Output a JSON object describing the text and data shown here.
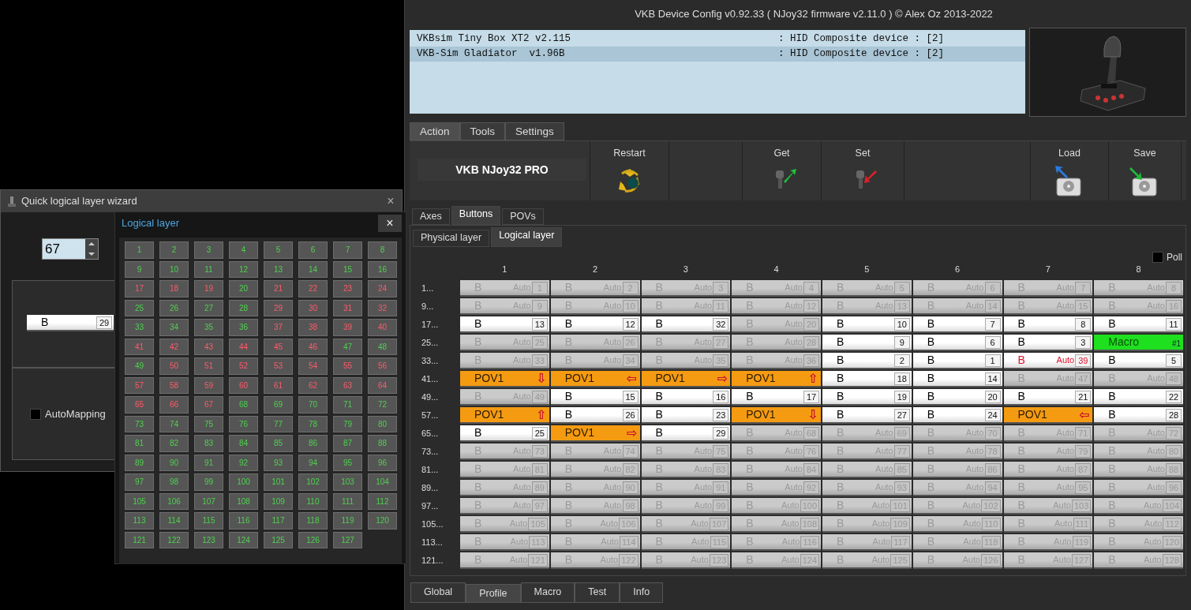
{
  "main_window": {
    "title": "VKB Device Config v0.92.33 ( NJoy32 firmware v2.11.0 ) © Alex Oz 2013-2022",
    "devices": [
      {
        "name": "VKBsim Tiny Box XT2 v2.115",
        "info": ": HID Composite device : [2]",
        "selected": false
      },
      {
        "name": "VKB-Sim Gladiator  v1.96B",
        "info": ": HID Composite device : [2]",
        "selected": true
      }
    ],
    "tabs": [
      {
        "label": "Action",
        "selected": true
      },
      {
        "label": "Tools",
        "selected": false
      },
      {
        "label": "Settings",
        "selected": false
      }
    ],
    "toolbar": {
      "device_label": "VKB NJoy32 PRO",
      "actions": [
        {
          "label": "Restart",
          "kind": "restart"
        },
        {
          "label": "Get",
          "kind": "get"
        },
        {
          "label": "Set",
          "kind": "set"
        },
        {
          "label": "Load",
          "kind": "load"
        },
        {
          "label": "Save",
          "kind": "save"
        }
      ]
    },
    "sub_tabs": [
      {
        "label": "Axes",
        "selected": false
      },
      {
        "label": "Buttons",
        "selected": true
      },
      {
        "label": "POVs",
        "selected": false
      }
    ],
    "layer_tabs": [
      {
        "label": "Physical layer",
        "selected": false
      },
      {
        "label": "Logical layer",
        "selected": true
      }
    ],
    "poll": {
      "label": "Poll",
      "checked": false
    },
    "columns": [
      "1",
      "2",
      "3",
      "4",
      "5",
      "6",
      "7",
      "8"
    ],
    "rows": [
      {
        "label": "1...",
        "cells": [
          {
            "kind": "auto",
            "text": "B",
            "mode": "Auto",
            "number": "1"
          },
          {
            "kind": "auto",
            "text": "B",
            "mode": "Auto",
            "number": "2"
          },
          {
            "kind": "auto",
            "text": "B",
            "mode": "Auto",
            "number": "3"
          },
          {
            "kind": "auto",
            "text": "B",
            "mode": "Auto",
            "number": "4"
          },
          {
            "kind": "auto",
            "text": "B",
            "mode": "Auto",
            "number": "5"
          },
          {
            "kind": "auto",
            "text": "B",
            "mode": "Auto",
            "number": "6"
          },
          {
            "kind": "auto",
            "text": "B",
            "mode": "Auto",
            "number": "7"
          },
          {
            "kind": "auto",
            "text": "B",
            "mode": "Auto",
            "number": "8"
          }
        ]
      },
      {
        "label": "9...",
        "cells": [
          {
            "kind": "auto",
            "text": "B",
            "mode": "Auto",
            "number": "9"
          },
          {
            "kind": "auto",
            "text": "B",
            "mode": "Auto",
            "number": "10"
          },
          {
            "kind": "auto",
            "text": "B",
            "mode": "Auto",
            "number": "11"
          },
          {
            "kind": "auto",
            "text": "B",
            "mode": "Auto",
            "number": "12"
          },
          {
            "kind": "auto",
            "text": "B",
            "mode": "Auto",
            "number": "13"
          },
          {
            "kind": "auto",
            "text": "B",
            "mode": "Auto",
            "number": "14"
          },
          {
            "kind": "auto",
            "text": "B",
            "mode": "Auto",
            "number": "15"
          },
          {
            "kind": "auto",
            "text": "B",
            "mode": "Auto",
            "number": "16"
          }
        ]
      },
      {
        "label": "17...",
        "cells": [
          {
            "kind": "button",
            "text": "B",
            "number": "13"
          },
          {
            "kind": "button",
            "text": "B",
            "number": "12"
          },
          {
            "kind": "button",
            "text": "B",
            "number": "32"
          },
          {
            "kind": "auto",
            "text": "B",
            "mode": "Auto",
            "number": "20"
          },
          {
            "kind": "button",
            "text": "B",
            "number": "10"
          },
          {
            "kind": "button",
            "text": "B",
            "number": "7"
          },
          {
            "kind": "button",
            "text": "B",
            "number": "8"
          },
          {
            "kind": "button",
            "text": "B",
            "number": "11"
          }
        ]
      },
      {
        "label": "25...",
        "cells": [
          {
            "kind": "auto",
            "text": "B",
            "mode": "Auto",
            "number": "25"
          },
          {
            "kind": "auto",
            "text": "B",
            "mode": "Auto",
            "number": "26"
          },
          {
            "kind": "auto",
            "text": "B",
            "mode": "Auto",
            "number": "27"
          },
          {
            "kind": "auto",
            "text": "B",
            "mode": "Auto",
            "number": "28"
          },
          {
            "kind": "button",
            "text": "B",
            "number": "9"
          },
          {
            "kind": "button",
            "text": "B",
            "number": "6"
          },
          {
            "kind": "button",
            "text": "B",
            "number": "3"
          },
          {
            "kind": "macro",
            "text": "Macro",
            "number": "#1"
          }
        ]
      },
      {
        "label": "33...",
        "cells": [
          {
            "kind": "auto",
            "text": "B",
            "mode": "Auto",
            "number": "33"
          },
          {
            "kind": "auto",
            "text": "B",
            "mode": "Auto",
            "number": "34"
          },
          {
            "kind": "auto",
            "text": "B",
            "mode": "Auto",
            "number": "35"
          },
          {
            "kind": "auto",
            "text": "B",
            "mode": "Auto",
            "number": "36"
          },
          {
            "kind": "button",
            "text": "B",
            "number": "2"
          },
          {
            "kind": "button",
            "text": "B",
            "number": "1"
          },
          {
            "kind": "conflict",
            "text": "B",
            "mode": "Auto",
            "number": "39"
          },
          {
            "kind": "button",
            "text": "B",
            "number": "5"
          }
        ]
      },
      {
        "label": "41...",
        "cells": [
          {
            "kind": "pov",
            "text": "POV1",
            "arrow": "⇩"
          },
          {
            "kind": "pov",
            "text": "POV1",
            "arrow": "⇦"
          },
          {
            "kind": "pov",
            "text": "POV1",
            "arrow": "⇨"
          },
          {
            "kind": "pov",
            "text": "POV1",
            "arrow": "⇧"
          },
          {
            "kind": "button",
            "text": "B",
            "number": "18"
          },
          {
            "kind": "button",
            "text": "B",
            "number": "14"
          },
          {
            "kind": "auto",
            "text": "B",
            "mode": "Auto",
            "number": "47"
          },
          {
            "kind": "auto",
            "text": "B",
            "mode": "Auto",
            "number": "48"
          }
        ]
      },
      {
        "label": "49...",
        "cells": [
          {
            "kind": "auto",
            "text": "B",
            "mode": "Auto",
            "number": "49"
          },
          {
            "kind": "button",
            "text": "B",
            "number": "15"
          },
          {
            "kind": "button",
            "text": "B",
            "number": "16"
          },
          {
            "kind": "button",
            "text": "B",
            "number": "17"
          },
          {
            "kind": "button",
            "text": "B",
            "number": "19"
          },
          {
            "kind": "button",
            "text": "B",
            "number": "20"
          },
          {
            "kind": "button",
            "text": "B",
            "number": "21"
          },
          {
            "kind": "button",
            "text": "B",
            "number": "22"
          }
        ]
      },
      {
        "label": "57...",
        "cells": [
          {
            "kind": "pov",
            "text": "POV1",
            "arrow": "⇧"
          },
          {
            "kind": "button",
            "text": "B",
            "number": "26"
          },
          {
            "kind": "button",
            "text": "B",
            "number": "23"
          },
          {
            "kind": "pov",
            "text": "POV1",
            "arrow": "⇩"
          },
          {
            "kind": "button",
            "text": "B",
            "number": "27"
          },
          {
            "kind": "button",
            "text": "B",
            "number": "24"
          },
          {
            "kind": "pov",
            "text": "POV1",
            "arrow": "⇦"
          },
          {
            "kind": "button",
            "text": "B",
            "number": "28"
          }
        ]
      },
      {
        "label": "65...",
        "cells": [
          {
            "kind": "button",
            "text": "B",
            "number": "25"
          },
          {
            "kind": "pov",
            "text": "POV1",
            "arrow": "⇨"
          },
          {
            "kind": "button",
            "text": "B",
            "number": "29"
          },
          {
            "kind": "auto",
            "text": "B",
            "mode": "Auto",
            "number": "68"
          },
          {
            "kind": "auto",
            "text": "B",
            "mode": "Auto",
            "number": "69"
          },
          {
            "kind": "auto",
            "text": "B",
            "mode": "Auto",
            "number": "70"
          },
          {
            "kind": "auto",
            "text": "B",
            "mode": "Auto",
            "number": "71"
          },
          {
            "kind": "auto",
            "text": "B",
            "mode": "Auto",
            "number": "72"
          }
        ]
      },
      {
        "label": "73...",
        "cells": [
          {
            "kind": "auto",
            "text": "B",
            "mode": "Auto",
            "number": "73"
          },
          {
            "kind": "auto",
            "text": "B",
            "mode": "Auto",
            "number": "74"
          },
          {
            "kind": "auto",
            "text": "B",
            "mode": "Auto",
            "number": "75"
          },
          {
            "kind": "auto",
            "text": "B",
            "mode": "Auto",
            "number": "76"
          },
          {
            "kind": "auto",
            "text": "B",
            "mode": "Auto",
            "number": "77"
          },
          {
            "kind": "auto",
            "text": "B",
            "mode": "Auto",
            "number": "78"
          },
          {
            "kind": "auto",
            "text": "B",
            "mode": "Auto",
            "number": "79"
          },
          {
            "kind": "auto",
            "text": "B",
            "mode": "Auto",
            "number": "80"
          }
        ]
      },
      {
        "label": "81...",
        "cells": [
          {
            "kind": "auto",
            "text": "B",
            "mode": "Auto",
            "number": "81"
          },
          {
            "kind": "auto",
            "text": "B",
            "mode": "Auto",
            "number": "82"
          },
          {
            "kind": "auto",
            "text": "B",
            "mode": "Auto",
            "number": "83"
          },
          {
            "kind": "auto",
            "text": "B",
            "mode": "Auto",
            "number": "84"
          },
          {
            "kind": "auto",
            "text": "B",
            "mode": "Auto",
            "number": "85"
          },
          {
            "kind": "auto",
            "text": "B",
            "mode": "Auto",
            "number": "86"
          },
          {
            "kind": "auto",
            "text": "B",
            "mode": "Auto",
            "number": "87"
          },
          {
            "kind": "auto",
            "text": "B",
            "mode": "Auto",
            "number": "88"
          }
        ]
      },
      {
        "label": "89...",
        "cells": [
          {
            "kind": "auto",
            "text": "B",
            "mode": "Auto",
            "number": "89"
          },
          {
            "kind": "auto",
            "text": "B",
            "mode": "Auto",
            "number": "90"
          },
          {
            "kind": "auto",
            "text": "B",
            "mode": "Auto",
            "number": "91"
          },
          {
            "kind": "auto",
            "text": "B",
            "mode": "Auto",
            "number": "92"
          },
          {
            "kind": "auto",
            "text": "B",
            "mode": "Auto",
            "number": "93"
          },
          {
            "kind": "auto",
            "text": "B",
            "mode": "Auto",
            "number": "94"
          },
          {
            "kind": "auto",
            "text": "B",
            "mode": "Auto",
            "number": "95"
          },
          {
            "kind": "auto",
            "text": "B",
            "mode": "Auto",
            "number": "96"
          }
        ]
      },
      {
        "label": "97...",
        "cells": [
          {
            "kind": "auto",
            "text": "B",
            "mode": "Auto",
            "number": "97"
          },
          {
            "kind": "auto",
            "text": "B",
            "mode": "Auto",
            "number": "98"
          },
          {
            "kind": "auto",
            "text": "B",
            "mode": "Auto",
            "number": "99"
          },
          {
            "kind": "auto",
            "text": "B",
            "mode": "Auto",
            "number": "100"
          },
          {
            "kind": "auto",
            "text": "B",
            "mode": "Auto",
            "number": "101"
          },
          {
            "kind": "auto",
            "text": "B",
            "mode": "Auto",
            "number": "102"
          },
          {
            "kind": "auto",
            "text": "B",
            "mode": "Auto",
            "number": "103"
          },
          {
            "kind": "auto",
            "text": "B",
            "mode": "Auto",
            "number": "104"
          }
        ]
      },
      {
        "label": "105...",
        "cells": [
          {
            "kind": "auto",
            "text": "B",
            "mode": "Auto",
            "number": "105"
          },
          {
            "kind": "auto",
            "text": "B",
            "mode": "Auto",
            "number": "106"
          },
          {
            "kind": "auto",
            "text": "B",
            "mode": "Auto",
            "number": "107"
          },
          {
            "kind": "auto",
            "text": "B",
            "mode": "Auto",
            "number": "108"
          },
          {
            "kind": "auto",
            "text": "B",
            "mode": "Auto",
            "number": "109"
          },
          {
            "kind": "auto",
            "text": "B",
            "mode": "Auto",
            "number": "110"
          },
          {
            "kind": "auto",
            "text": "B",
            "mode": "Auto",
            "number": "111"
          },
          {
            "kind": "auto",
            "text": "B",
            "mode": "Auto",
            "number": "112"
          }
        ]
      },
      {
        "label": "113...",
        "cells": [
          {
            "kind": "auto",
            "text": "B",
            "mode": "Auto",
            "number": "113"
          },
          {
            "kind": "auto",
            "text": "B",
            "mode": "Auto",
            "number": "114"
          },
          {
            "kind": "auto",
            "text": "B",
            "mode": "Auto",
            "number": "115"
          },
          {
            "kind": "auto",
            "text": "B",
            "mode": "Auto",
            "number": "116"
          },
          {
            "kind": "auto",
            "text": "B",
            "mode": "Auto",
            "number": "117"
          },
          {
            "kind": "auto",
            "text": "B",
            "mode": "Auto",
            "number": "118"
          },
          {
            "kind": "auto",
            "text": "B",
            "mode": "Auto",
            "number": "119"
          },
          {
            "kind": "auto",
            "text": "B",
            "mode": "Auto",
            "number": "120"
          }
        ]
      },
      {
        "label": "121...",
        "cells": [
          {
            "kind": "auto",
            "text": "B",
            "mode": "Auto",
            "number": "121"
          },
          {
            "kind": "auto",
            "text": "B",
            "mode": "Auto",
            "number": "122"
          },
          {
            "kind": "auto",
            "text": "B",
            "mode": "Auto",
            "number": "123"
          },
          {
            "kind": "auto",
            "text": "B",
            "mode": "Auto",
            "number": "124"
          },
          {
            "kind": "auto",
            "text": "B",
            "mode": "Auto",
            "number": "125"
          },
          {
            "kind": "auto",
            "text": "B",
            "mode": "Auto",
            "number": "126"
          },
          {
            "kind": "auto",
            "text": "B",
            "mode": "Auto",
            "number": "127"
          },
          {
            "kind": "auto",
            "text": "B",
            "mode": "Auto",
            "number": "128"
          }
        ]
      }
    ],
    "bottom_tabs": [
      {
        "label": "Global",
        "selected": false
      },
      {
        "label": "Profile",
        "selected": true
      },
      {
        "label": "Macro",
        "selected": false
      },
      {
        "label": "Test",
        "selected": false
      },
      {
        "label": "Info",
        "selected": false
      }
    ]
  },
  "wizard": {
    "title": "Quick logical layer wizard",
    "close": "×",
    "spinner_value": "67",
    "slot": {
      "kind": "button",
      "text": "B",
      "number": "29"
    },
    "automapping": {
      "label": "AutoMapping",
      "checked": false
    }
  },
  "logical_layer": {
    "title": "Logical layer",
    "close": "×",
    "buttons": [
      {
        "label": "1",
        "assigned": false
      },
      {
        "label": "2",
        "assigned": false
      },
      {
        "label": "3",
        "assigned": false
      },
      {
        "label": "4",
        "assigned": false
      },
      {
        "label": "5",
        "assigned": false
      },
      {
        "label": "6",
        "assigned": false
      },
      {
        "label": "7",
        "assigned": false
      },
      {
        "label": "8",
        "assigned": false
      },
      {
        "label": "9",
        "assigned": false
      },
      {
        "label": "10",
        "assigned": false
      },
      {
        "label": "11",
        "assigned": false
      },
      {
        "label": "12",
        "assigned": false
      },
      {
        "label": "13",
        "assigned": false
      },
      {
        "label": "14",
        "assigned": false
      },
      {
        "label": "15",
        "assigned": false
      },
      {
        "label": "16",
        "assigned": false
      },
      {
        "label": "17",
        "assigned": true
      },
      {
        "label": "18",
        "assigned": true
      },
      {
        "label": "19",
        "assigned": true
      },
      {
        "label": "20",
        "assigned": false
      },
      {
        "label": "21",
        "assigned": true
      },
      {
        "label": "22",
        "assigned": true
      },
      {
        "label": "23",
        "assigned": true
      },
      {
        "label": "24",
        "assigned": true
      },
      {
        "label": "25",
        "assigned": false
      },
      {
        "label": "26",
        "assigned": false
      },
      {
        "label": "27",
        "assigned": false
      },
      {
        "label": "28",
        "assigned": false
      },
      {
        "label": "29",
        "assigned": true
      },
      {
        "label": "30",
        "assigned": true
      },
      {
        "label": "31",
        "assigned": true
      },
      {
        "label": "32",
        "assigned": true
      },
      {
        "label": "33",
        "assigned": false
      },
      {
        "label": "34",
        "assigned": false
      },
      {
        "label": "35",
        "assigned": false
      },
      {
        "label": "36",
        "assigned": false
      },
      {
        "label": "37",
        "assigned": true
      },
      {
        "label": "38",
        "assigned": true
      },
      {
        "label": "39",
        "assigned": true
      },
      {
        "label": "40",
        "assigned": true
      },
      {
        "label": "41",
        "assigned": true
      },
      {
        "label": "42",
        "assigned": true
      },
      {
        "label": "43",
        "assigned": true
      },
      {
        "label": "44",
        "assigned": true
      },
      {
        "label": "45",
        "assigned": true
      },
      {
        "label": "46",
        "assigned": true
      },
      {
        "label": "47",
        "assigned": false
      },
      {
        "label": "48",
        "assigned": false
      },
      {
        "label": "49",
        "assigned": false
      },
      {
        "label": "50",
        "assigned": true
      },
      {
        "label": "51",
        "assigned": true
      },
      {
        "label": "52",
        "assigned": true
      },
      {
        "label": "53",
        "assigned": true
      },
      {
        "label": "54",
        "assigned": true
      },
      {
        "label": "55",
        "assigned": true
      },
      {
        "label": "56",
        "assigned": true
      },
      {
        "label": "57",
        "assigned": true
      },
      {
        "label": "58",
        "assigned": true
      },
      {
        "label": "59",
        "assigned": true
      },
      {
        "label": "60",
        "assigned": true
      },
      {
        "label": "61",
        "assigned": true
      },
      {
        "label": "62",
        "assigned": true
      },
      {
        "label": "63",
        "assigned": true
      },
      {
        "label": "64",
        "assigned": true
      },
      {
        "label": "65",
        "assigned": true
      },
      {
        "label": "66",
        "assigned": true
      },
      {
        "label": "67",
        "assigned": true
      },
      {
        "label": "68",
        "assigned": false
      },
      {
        "label": "69",
        "assigned": false
      },
      {
        "label": "70",
        "assigned": false
      },
      {
        "label": "71",
        "assigned": false
      },
      {
        "label": "72",
        "assigned": false
      },
      {
        "label": "73",
        "assigned": false
      },
      {
        "label": "74",
        "assigned": false
      },
      {
        "label": "75",
        "assigned": false
      },
      {
        "label": "76",
        "assigned": false
      },
      {
        "label": "77",
        "assigned": false
      },
      {
        "label": "78",
        "assigned": false
      },
      {
        "label": "79",
        "assigned": false
      },
      {
        "label": "80",
        "assigned": false
      },
      {
        "label": "81",
        "assigned": false
      },
      {
        "label": "82",
        "assigned": false
      },
      {
        "label": "83",
        "assigned": false
      },
      {
        "label": "84",
        "assigned": false
      },
      {
        "label": "85",
        "assigned": false
      },
      {
        "label": "86",
        "assigned": false
      },
      {
        "label": "87",
        "assigned": false
      },
      {
        "label": "88",
        "assigned": false
      },
      {
        "label": "89",
        "assigned": false
      },
      {
        "label": "90",
        "assigned": false
      },
      {
        "label": "91",
        "assigned": false
      },
      {
        "label": "92",
        "assigned": false
      },
      {
        "label": "93",
        "assigned": false
      },
      {
        "label": "94",
        "assigned": false
      },
      {
        "label": "95",
        "assigned": false
      },
      {
        "label": "96",
        "assigned": false
      },
      {
        "label": "97",
        "assigned": false
      },
      {
        "label": "98",
        "assigned": false
      },
      {
        "label": "99",
        "assigned": false
      },
      {
        "label": "100",
        "assigned": false
      },
      {
        "label": "101",
        "assigned": false
      },
      {
        "label": "102",
        "assigned": false
      },
      {
        "label": "103",
        "assigned": false
      },
      {
        "label": "104",
        "assigned": false
      },
      {
        "label": "105",
        "assigned": false
      },
      {
        "label": "106",
        "assigned": false
      },
      {
        "label": "107",
        "assigned": false
      },
      {
        "label": "108",
        "assigned": false
      },
      {
        "label": "109",
        "assigned": false
      },
      {
        "label": "110",
        "assigned": false
      },
      {
        "label": "111",
        "assigned": false
      },
      {
        "label": "112",
        "assigned": false
      },
      {
        "label": "113",
        "assigned": false
      },
      {
        "label": "114",
        "assigned": false
      },
      {
        "label": "115",
        "assigned": false
      },
      {
        "label": "116",
        "assigned": false
      },
      {
        "label": "117",
        "assigned": false
      },
      {
        "label": "118",
        "assigned": false
      },
      {
        "label": "119",
        "assigned": false
      },
      {
        "label": "120",
        "assigned": false
      },
      {
        "label": "121",
        "assigned": false
      },
      {
        "label": "122",
        "assigned": false
      },
      {
        "label": "123",
        "assigned": false
      },
      {
        "label": "124",
        "assigned": false
      },
      {
        "label": "125",
        "assigned": false
      },
      {
        "label": "126",
        "assigned": false
      },
      {
        "label": "127",
        "assigned": false
      }
    ]
  }
}
